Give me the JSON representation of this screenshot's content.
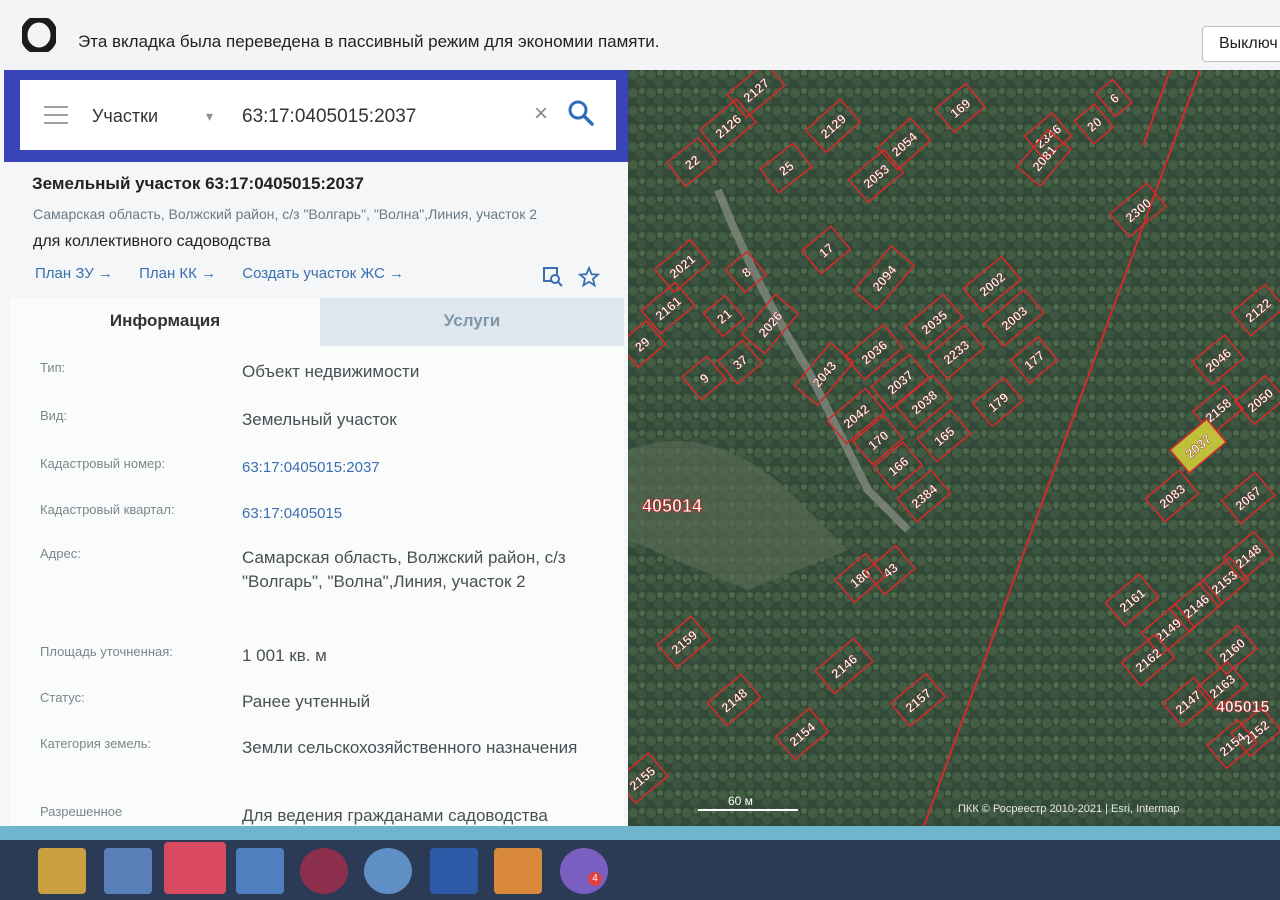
{
  "browser_notice": {
    "text": "Эта вкладка была переведена в пассивный режим для экономии памяти.",
    "button": "Выключ"
  },
  "search": {
    "type_label": "Участки",
    "value": "63:17:0405015:2037"
  },
  "object": {
    "title": "Земельный участок 63:17:0405015:2037",
    "address": "Самарская область, Волжский район, с/з \"Волгарь\", \"Волна\",Линия, участок 2",
    "use": "для коллективного садоводства",
    "links": [
      "План ЗУ →",
      "План КК →",
      "Создать участок ЖС →"
    ]
  },
  "tabs": {
    "info": "Информация",
    "services": "Услуги"
  },
  "info": {
    "type_label": "Тип:",
    "type_value": "Объект недвижимости",
    "kind_label": "Вид:",
    "kind_value": "Земельный участок",
    "cad_num_label": "Кадастровый номер:",
    "cad_num_value": "63:17:0405015:2037",
    "cad_q_label": "Кадастровый квартал:",
    "cad_q_value": "63:17:0405015",
    "addr_label": "Адрес:",
    "addr_value": "Самарская область, Волжский район, с/з \"Волгарь\", \"Волна\",Линия, участок 2",
    "area_label": "Площадь уточненная:",
    "area_value": "1 001 кв. м",
    "status_label": "Статус:",
    "status_value": "Ранее учтенный",
    "cat_label": "Категория земель:",
    "cat_value": "Земли сельскохозяйственного назначения",
    "permit_label": "Разрешенное",
    "permit_value": "Для ведения гражданами садоводства"
  },
  "map": {
    "quarter_left": "405014",
    "quarter_right": "405015",
    "scale": "60 м",
    "attribution": "ПКК © Росреестр 2010-2021 | Esri, Intermap",
    "highlight_color": "#d6d23a",
    "parcel_color": "#d42a2a",
    "parcels": [
      {
        "label": "2127"
      },
      {
        "label": "2126"
      },
      {
        "label": "2129"
      },
      {
        "label": "169"
      },
      {
        "label": "2054"
      },
      {
        "label": "2053"
      },
      {
        "label": "2346"
      },
      {
        "label": "2081"
      },
      {
        "label": "20"
      },
      {
        "label": "6"
      },
      {
        "label": "22"
      },
      {
        "label": "25"
      },
      {
        "label": "2300"
      },
      {
        "label": "2021"
      },
      {
        "label": "8"
      },
      {
        "label": "17"
      },
      {
        "label": "2094"
      },
      {
        "label": "2002"
      },
      {
        "label": "2003"
      },
      {
        "label": "2161"
      },
      {
        "label": "21"
      },
      {
        "label": "2026"
      },
      {
        "label": "2035"
      },
      {
        "label": "2036"
      },
      {
        "label": "2233"
      },
      {
        "label": "177"
      },
      {
        "label": "29"
      },
      {
        "label": "9"
      },
      {
        "label": "37"
      },
      {
        "label": "2043"
      },
      {
        "label": "2037"
      },
      {
        "label": "2038"
      },
      {
        "label": "179"
      },
      {
        "label": "2042"
      },
      {
        "label": "170"
      },
      {
        "label": "165"
      },
      {
        "label": "166"
      },
      {
        "label": "2384"
      },
      {
        "label": "180"
      },
      {
        "label": "43"
      },
      {
        "label": "2159"
      },
      {
        "label": "2146"
      },
      {
        "label": "2148"
      },
      {
        "label": "2154"
      },
      {
        "label": "2157"
      },
      {
        "label": "2155"
      },
      {
        "label": "2122"
      },
      {
        "label": "2046"
      },
      {
        "label": "2050"
      },
      {
        "label": "2158"
      },
      {
        "label": "2037",
        "highlighted": true
      },
      {
        "label": "2083"
      },
      {
        "label": "2067"
      },
      {
        "label": "2148"
      },
      {
        "label": "2153"
      },
      {
        "label": "2161"
      },
      {
        "label": "2146"
      },
      {
        "label": "2149"
      },
      {
        "label": "2162"
      },
      {
        "label": "2160"
      },
      {
        "label": "2163"
      },
      {
        "label": "2147"
      },
      {
        "label": "2152"
      },
      {
        "label": "2154"
      }
    ]
  },
  "taskbar": {
    "icons": [
      "folder-icon",
      "store-icon",
      "opera-icon",
      "maps-icon",
      "media-icon",
      "chat-icon",
      "word-icon",
      "files-icon",
      "viber-icon"
    ],
    "viber_badge": "4"
  }
}
